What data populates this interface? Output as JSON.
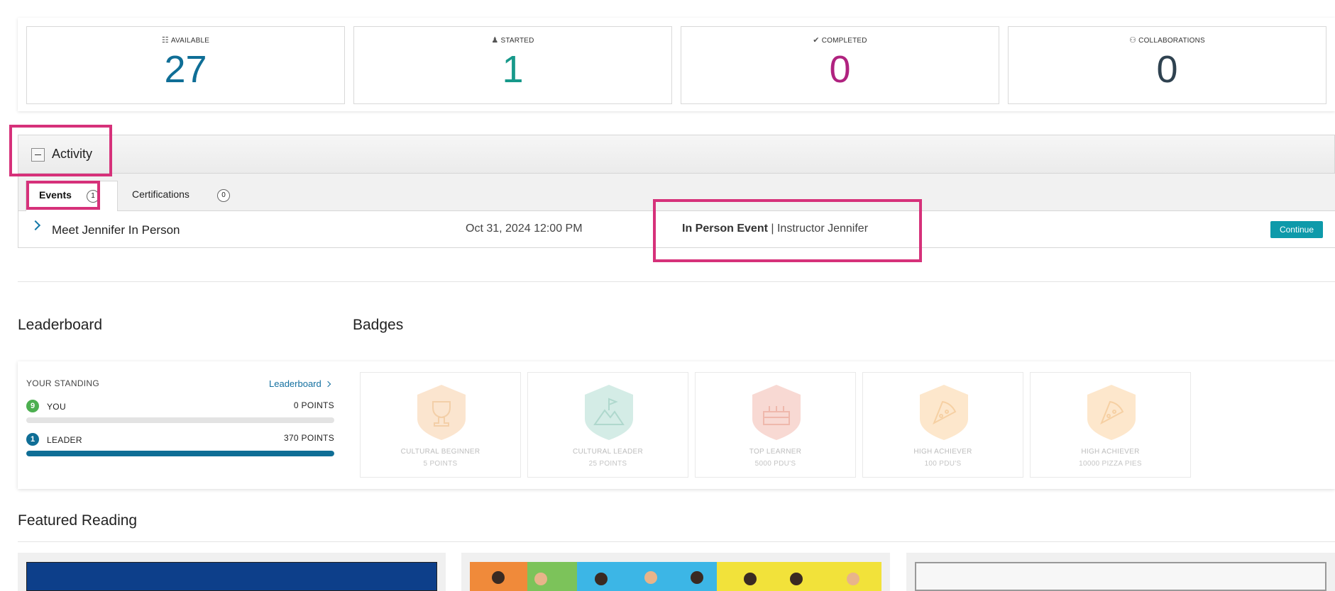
{
  "stats": [
    {
      "icon": "book-icon",
      "glyph": "☷",
      "label": "AVAILABLE",
      "value": "27",
      "color": "#0f6e96"
    },
    {
      "icon": "learners-icon",
      "glyph": "♟",
      "label": "STARTED",
      "value": "1",
      "color": "#17998a"
    },
    {
      "icon": "check-icon",
      "glyph": "✔",
      "label": "COMPLETED",
      "value": "0",
      "color": "#b0227f"
    },
    {
      "icon": "people-icon",
      "glyph": "⚇",
      "label": "COLLABORATIONS",
      "value": "0",
      "color": "#2f4250"
    }
  ],
  "activity": {
    "title": "Activity",
    "tabs": [
      {
        "label": "Events",
        "count": "1",
        "active": true
      },
      {
        "label": "Certifications",
        "count": "0",
        "active": false
      }
    ],
    "events": [
      {
        "title": "Meet Jennifer In Person",
        "date": "Oct 31, 2024 12:00 PM",
        "type_bold": "In Person Event",
        "type_sep": " | ",
        "type_rest": "Instructor Jennifer",
        "action": "Continue"
      }
    ]
  },
  "leaderboard": {
    "heading": "Leaderboard",
    "standing_label": "YOUR STANDING",
    "link_label": "Leaderboard",
    "rows": [
      {
        "rank": "9",
        "name": "YOU",
        "points": "0 POINTS",
        "progress": 0.0,
        "color": "#4caf50"
      },
      {
        "rank": "1",
        "name": "LEADER",
        "points": "370 POINTS",
        "progress": 1.0,
        "color": "#0f6e96"
      }
    ]
  },
  "badges": {
    "heading": "Badges",
    "items": [
      {
        "name": "CULTURAL BEGINNER",
        "sub": "5 POINTS",
        "icon": "trophy-icon",
        "glyph": "🏆",
        "color": "#fbe5cf"
      },
      {
        "name": "CULTURAL LEADER",
        "sub": "25 POINTS",
        "icon": "mountain-flag-icon",
        "glyph": "⛰",
        "color": "#d4ece6"
      },
      {
        "name": "TOP LEARNER",
        "sub": "5000 PDU'S",
        "icon": "cake-icon",
        "glyph": "🎂",
        "color": "#f8d9d3"
      },
      {
        "name": "HIGH ACHIEVER",
        "sub": "100 PDU'S",
        "icon": "pizza-icon",
        "glyph": "🍕",
        "color": "#fde7cc"
      },
      {
        "name": "HIGH ACHIEVER",
        "sub": "10000 PIZZA PIES",
        "icon": "pizza-icon",
        "glyph": "🍕",
        "color": "#fde7cc"
      }
    ]
  },
  "featured_reading": {
    "heading": "Featured Reading"
  }
}
